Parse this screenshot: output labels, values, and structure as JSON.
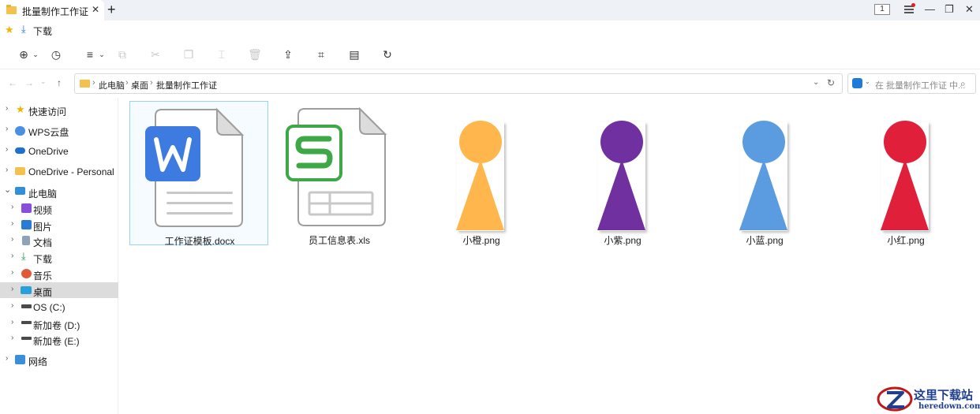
{
  "titlebar": {
    "tab_title": "批量制作工作证",
    "tab_close": "✕",
    "new_tab": "+",
    "page_badge": "1",
    "minimize": "—",
    "restore": "❐",
    "close": "✕"
  },
  "bookmarks": {
    "download_label": "下载"
  },
  "toolbar": {
    "icons": [
      "new-icon",
      "clock-icon",
      "view-icon",
      "copy-icon",
      "cut-icon",
      "paste-icon",
      "rename-icon",
      "delete-icon",
      "share-icon",
      "crop-icon",
      "save-icon",
      "refresh-icon"
    ]
  },
  "address": {
    "crumbs": [
      "此电脑",
      "桌面",
      "批量制作工作证"
    ],
    "separator": "›"
  },
  "search": {
    "placeholder": "在 批量制作工作证 中..."
  },
  "sidebar": {
    "items": [
      {
        "label": "快速访问",
        "icon": "star-icon"
      },
      {
        "label": "WPS云盘",
        "icon": "wps-cloud-icon"
      },
      {
        "label": "OneDrive",
        "icon": "onedrive-icon"
      },
      {
        "label": "OneDrive - Personal",
        "icon": "folder-icon"
      },
      {
        "label": "此电脑",
        "icon": "computer-icon"
      },
      {
        "label": "视频",
        "icon": "video-icon"
      },
      {
        "label": "图片",
        "icon": "pictures-icon"
      },
      {
        "label": "文档",
        "icon": "documents-icon"
      },
      {
        "label": "下载",
        "icon": "download-icon"
      },
      {
        "label": "音乐",
        "icon": "music-icon"
      },
      {
        "label": "桌面",
        "icon": "desktop-icon"
      },
      {
        "label": "OS (C:)",
        "icon": "drive-icon"
      },
      {
        "label": "新加卷 (D:)",
        "icon": "drive-icon"
      },
      {
        "label": "新加卷 (E:)",
        "icon": "drive-icon"
      },
      {
        "label": "网络",
        "icon": "network-icon"
      }
    ]
  },
  "files": [
    {
      "name": "工作证模板.docx",
      "icon": "word-doc-icon"
    },
    {
      "name": "员工信息表.xls",
      "icon": "excel-sheet-icon"
    },
    {
      "name": "小橙.png",
      "icon": "pawn-image-icon",
      "color": "#FFB74D"
    },
    {
      "name": "小紫.png",
      "icon": "pawn-image-icon",
      "color": "#7030A0"
    },
    {
      "name": "小蓝.png",
      "icon": "pawn-image-icon",
      "color": "#5B9BE0"
    },
    {
      "name": "小红.png",
      "icon": "pawn-image-icon",
      "color": "#E0203A"
    }
  ],
  "colors": {
    "word_blue": "#3D7BE0",
    "wps_green": "#3DA845",
    "selection_border": "#99D1FF",
    "sidebar_selected": "#DCDCDC"
  },
  "watermark": {
    "title": "这里下载站",
    "url": "heredown.com"
  }
}
